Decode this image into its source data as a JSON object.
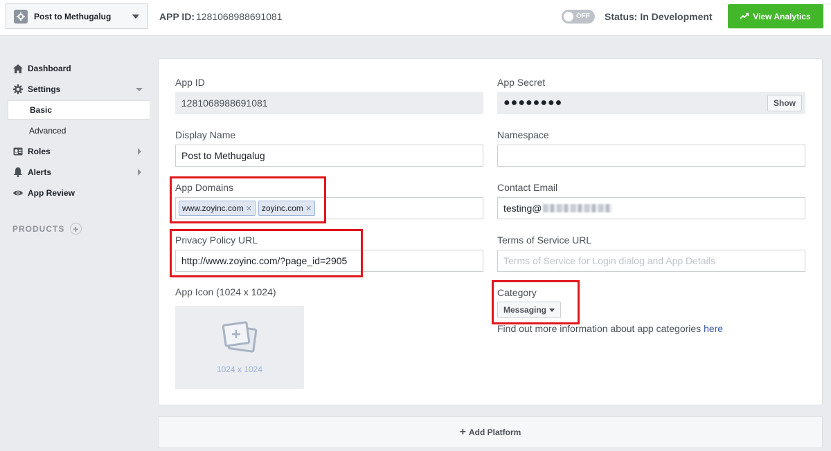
{
  "topbar": {
    "app_name": "Post to Methugalug",
    "app_id_label": "APP ID:",
    "app_id_value": "1281068988691081",
    "toggle_text": "OFF",
    "status_text": "Status: In Development",
    "analytics_label": "View Analytics"
  },
  "sidebar": {
    "dashboard": "Dashboard",
    "settings": "Settings",
    "basic": "Basic",
    "advanced": "Advanced",
    "roles": "Roles",
    "alerts": "Alerts",
    "app_review": "App Review",
    "products": "PRODUCTS"
  },
  "form": {
    "app_id_label": "App ID",
    "app_id_value": "1281068988691081",
    "app_secret_label": "App Secret",
    "app_secret_value": "●●●●●●●●",
    "show_label": "Show",
    "display_name_label": "Display Name",
    "display_name_value": "Post to Methugalug",
    "namespace_label": "Namespace",
    "namespace_value": "",
    "app_domains_label": "App Domains",
    "app_domains": [
      "www.zoyinc.com",
      "zoyinc.com"
    ],
    "contact_email_label": "Contact Email",
    "contact_email_value": "testing@",
    "privacy_label": "Privacy Policy URL",
    "privacy_value": "http://www.zoyinc.com/?page_id=2905",
    "tos_label": "Terms of Service URL",
    "tos_placeholder": "Terms of Service for Login dialog and App Details",
    "app_icon_label": "App Icon (1024 x 1024)",
    "app_icon_size": "1024 x 1024",
    "category_label": "Category",
    "category_value": "Messaging",
    "category_help": "Find out more information about app categories ",
    "category_help_link": "here"
  },
  "add_platform": "Add Platform",
  "colors": {
    "accent_green": "#42b72a",
    "highlight_red": "#e0171b",
    "link_blue": "#365899"
  }
}
